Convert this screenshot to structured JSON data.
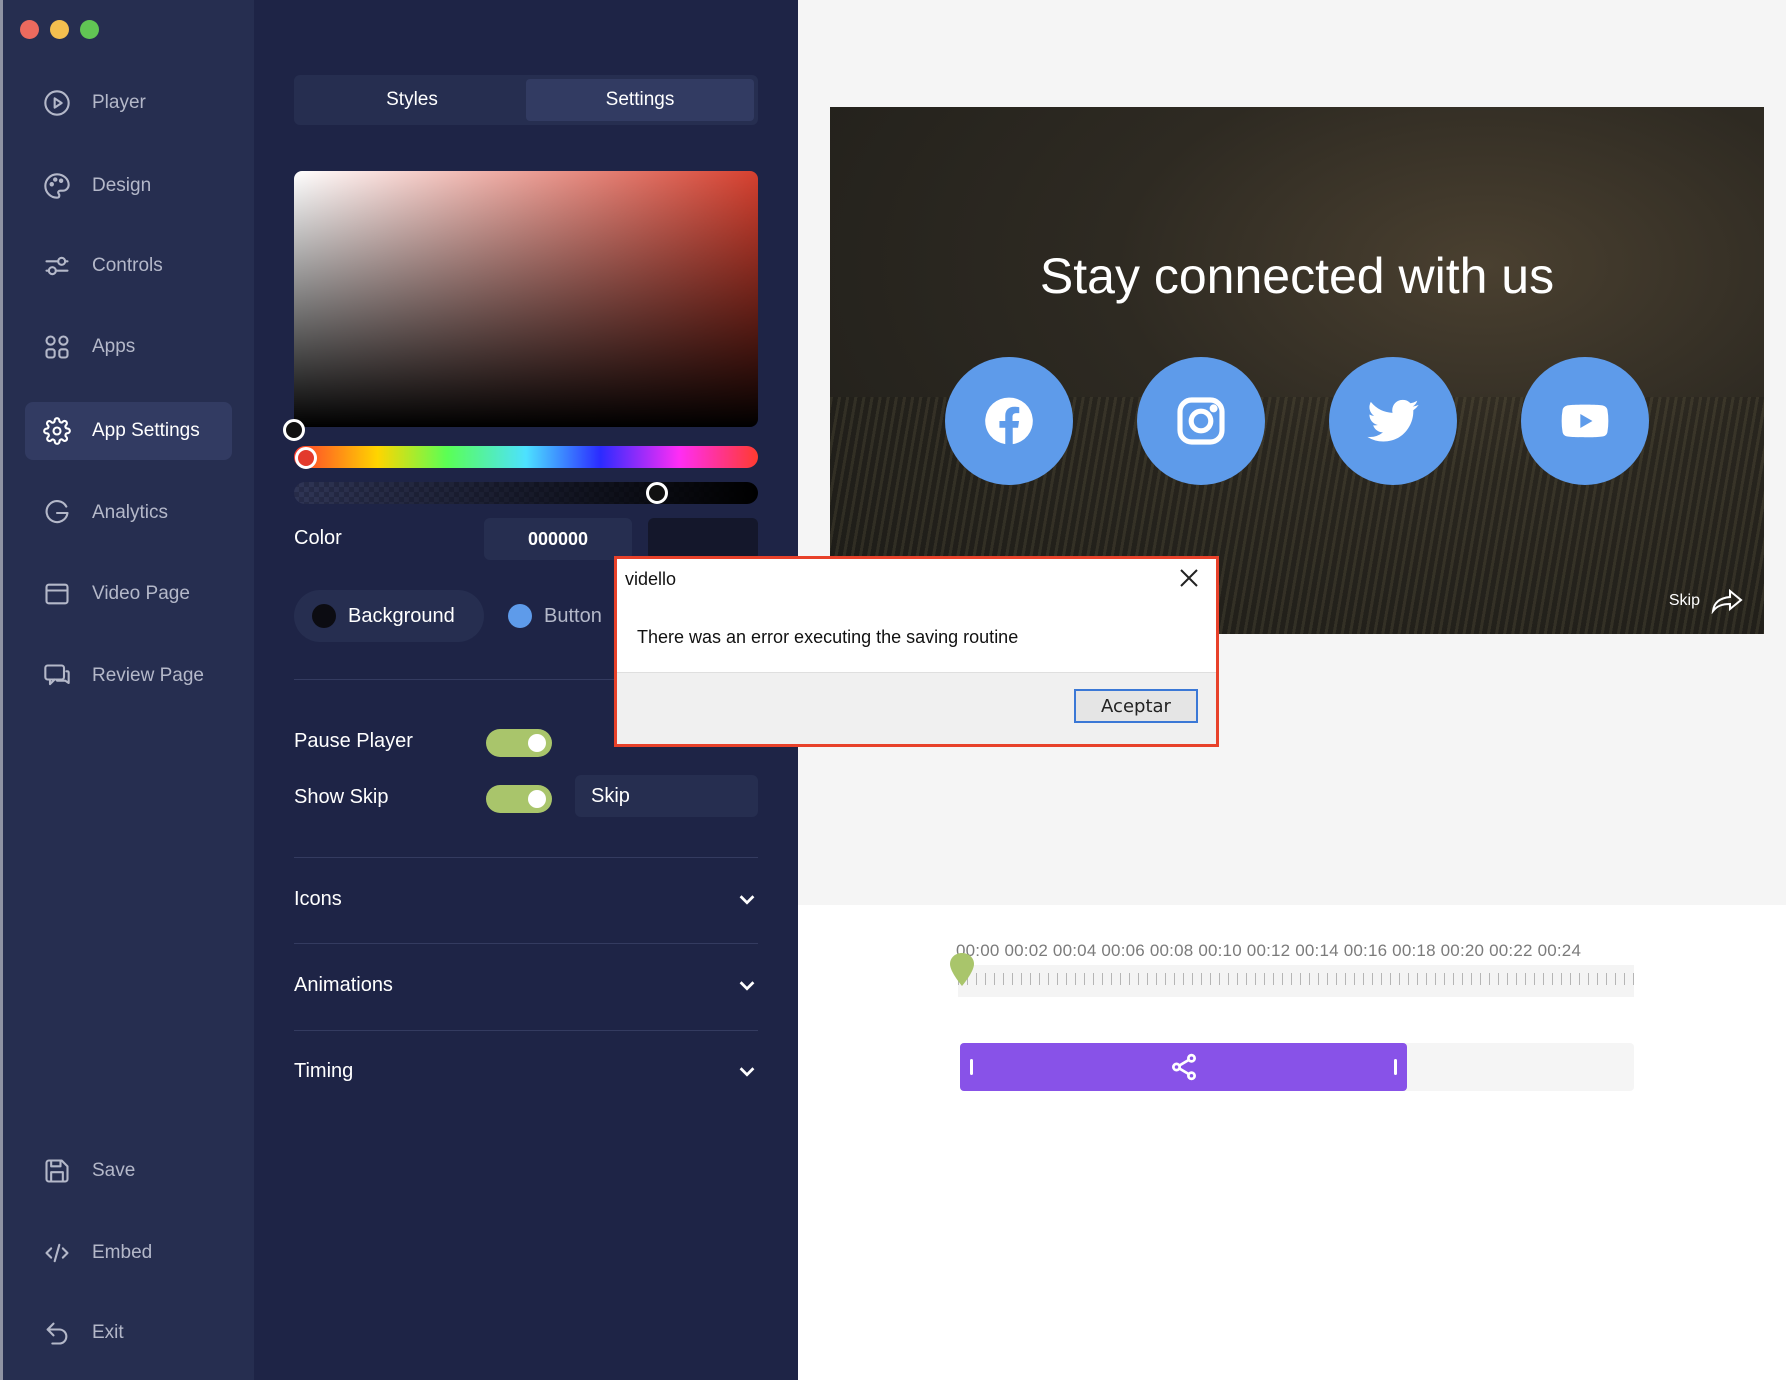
{
  "nav": {
    "items": [
      {
        "label": "Player",
        "icon": "play-circle-icon"
      },
      {
        "label": "Design",
        "icon": "palette-icon"
      },
      {
        "label": "Controls",
        "icon": "sliders-icon"
      },
      {
        "label": "Apps",
        "icon": "apps-grid-icon"
      },
      {
        "label": "App Settings",
        "icon": "gear-icon",
        "active": true
      },
      {
        "label": "Analytics",
        "icon": "analytics-icon"
      },
      {
        "label": "Video Page",
        "icon": "browser-window-icon"
      },
      {
        "label": "Review Page",
        "icon": "chat-icon"
      }
    ],
    "bottom": [
      {
        "label": "Save",
        "icon": "floppy-disk-icon"
      },
      {
        "label": "Embed",
        "icon": "code-icon"
      },
      {
        "label": "Exit",
        "icon": "exit-arrow-icon"
      }
    ]
  },
  "panel": {
    "tabs": {
      "styles": "Styles",
      "settings": "Settings",
      "active": "settings"
    },
    "color_picker": {
      "label": "Color",
      "hex": "000000",
      "hue_color": "#d6402f",
      "alpha_fraction": 0.77
    },
    "targets": {
      "background": "Background",
      "button": "Button",
      "background_dot": "#0c0c12",
      "button_dot": "#5e9bea"
    },
    "pause_player": {
      "label": "Pause Player",
      "on": true
    },
    "show_skip": {
      "label": "Show Skip",
      "on": true,
      "value": "Skip"
    },
    "sections": {
      "icons": "Icons",
      "animations": "Animations",
      "timing": "Timing"
    }
  },
  "preview": {
    "headline": "Stay connected with us",
    "socials": [
      "facebook-icon",
      "instagram-icon",
      "twitter-icon",
      "youtube-icon"
    ],
    "social_color": "#5e9bea",
    "skip_label": "Skip"
  },
  "timeline": {
    "ticks": "00:00 00:02 00:04 00:06 00:08 00:10 00:12 00:14 00:16 00:18 00:20 00:22 00:24",
    "clip_color": "#8852e8",
    "marker_color": "#a9c56b"
  },
  "dialog": {
    "title": "vidello",
    "message": "There was an error executing the saving routine",
    "ok_label": "Aceptar"
  }
}
